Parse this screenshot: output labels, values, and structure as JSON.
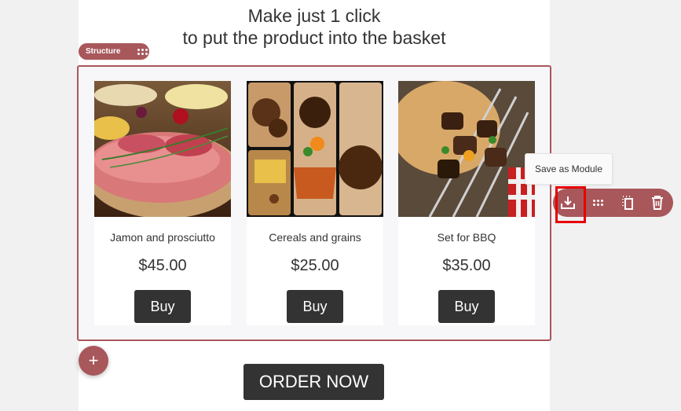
{
  "headline": {
    "line1": "Make just 1 click",
    "line2": "to put the product into the basket"
  },
  "structure_tag": {
    "label": "Structure"
  },
  "products": [
    {
      "name": "Jamon and prosciutto",
      "price": "$45.00",
      "button": "Buy"
    },
    {
      "name": "Cereals and grains",
      "price": "$25.00",
      "button": "Buy"
    },
    {
      "name": "Set for BBQ",
      "price": "$35.00",
      "button": "Buy"
    }
  ],
  "add_button": {
    "label": "+"
  },
  "order_button": {
    "label": "ORDER NOW"
  },
  "tooltip": {
    "text": "Save as Module"
  },
  "toolbar": {
    "tools": [
      "save-module-icon",
      "drag-handle-icon",
      "copy-icon",
      "trash-icon"
    ]
  },
  "colors": {
    "accent": "#a8575b",
    "button_dark": "#333333",
    "highlight": "#e60000"
  }
}
